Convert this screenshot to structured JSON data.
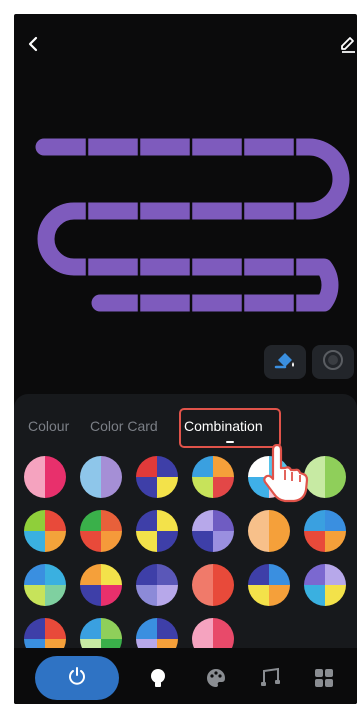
{
  "header": {
    "back_icon": "chevron-left-icon",
    "edit_icon": "pencil-icon"
  },
  "preview": {
    "strip_color": "#7e5bbd",
    "tools": [
      {
        "name": "paint-bucket-icon",
        "color": "#3a8fe0"
      },
      {
        "name": "circle-icon",
        "color": "#5a5d62"
      }
    ]
  },
  "tabs": {
    "colour": "Colour",
    "color_card": "Color Card",
    "combination": "Combination",
    "active": "combination"
  },
  "combinations": [
    [
      "#e8306c",
      "#f5a3bf"
    ],
    [
      "#a58fd6",
      "#8ec6ea"
    ],
    [
      "#3e3fa8",
      "#f3e24a",
      "#3e3fa8",
      "#e13a3a"
    ],
    [
      "#f5a03a",
      "#e34747",
      "#c7e35a",
      "#3aa0e0"
    ],
    [
      "#56c2e8",
      "#f3c7d6",
      "#3fb0e8",
      "#ffffff"
    ],
    [
      "#8fcf5a",
      "#c7eaa3"
    ],
    [
      "#e84a3a",
      "#f3a33a",
      "#3ab0e0",
      "#8fcf3a"
    ],
    [
      "#e8603a",
      "#f59a3a",
      "#e84a3a",
      "#3ab04a"
    ],
    [
      "#f3e24a",
      "#3e3fa8",
      "#f3e24a",
      "#3e3fa8"
    ],
    [
      "#6f5cc2",
      "#9a8fe0",
      "#3e3fa8",
      "#b7a8ea"
    ],
    [
      "#f5a03a",
      "#f7c08a"
    ],
    [
      "#3a8fe0",
      "#f5a03a",
      "#e84a3a",
      "#3aa0e0"
    ],
    [
      "#3ab0e0",
      "#7fd0a0",
      "#c7e35a",
      "#3a8fe0"
    ],
    [
      "#f3e24a",
      "#e8306c",
      "#3e3fa8",
      "#f5a03a"
    ],
    [
      "#5a57b8",
      "#b7a8ea",
      "#8c8ad8",
      "#3e3fa8"
    ],
    [
      "#e84a3a",
      "#f07a6a"
    ],
    [
      "#3a8fe0",
      "#f5a03a",
      "#f3e24a",
      "#3e3fa8"
    ],
    [
      "#b7a8ea",
      "#f3e24a",
      "#3ab0e0",
      "#7b68d0"
    ],
    [
      "#e84a3a",
      "#f5a03a",
      "#3a8fe0",
      "#3e3fa8"
    ],
    [
      "#8fcf5a",
      "#3ab04a",
      "#c7eaa3",
      "#3aa0e0"
    ],
    [
      "#3e3fa8",
      "#f5a03a",
      "#b7a8ea",
      "#3a8fe0"
    ],
    [
      "#e84a6a",
      "#f5a3bf"
    ]
  ],
  "power_button": {
    "icon": "power-icon",
    "color": "#2f73c4"
  },
  "bottom_nav": [
    {
      "icon": "bulb-icon",
      "active": true
    },
    {
      "icon": "palette-icon",
      "active": false
    },
    {
      "icon": "music-icon",
      "active": false
    },
    {
      "icon": "grid-icon",
      "active": false
    }
  ]
}
